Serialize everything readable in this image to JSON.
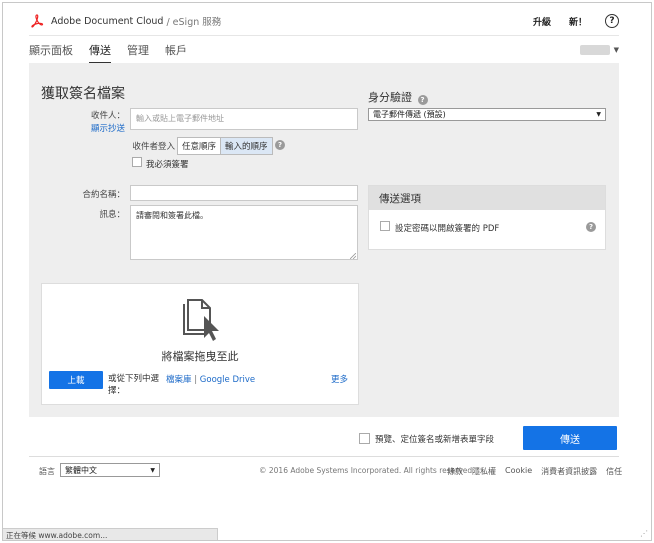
{
  "header": {
    "app_title": "Adobe Document Cloud",
    "app_sub": "/ eSign 服務",
    "upgrade": "升級",
    "whats_new": "新！",
    "help": "?"
  },
  "nav": {
    "tabs": [
      {
        "label": "顯示面板"
      },
      {
        "label": "傳送"
      },
      {
        "label": "管理"
      },
      {
        "label": "帳戶"
      }
    ],
    "active": "傳送"
  },
  "form": {
    "heading": "獲取簽名檔案",
    "recipient_label": "收件人：",
    "show_cc": "顯示抄送",
    "recipient_placeholder": "輸入或貼上電子郵件地址",
    "order_label": "收件者登入",
    "order_any": "任意順序",
    "order_entered": "輸入的順序",
    "i_must_sign": "我必須簽署",
    "agreement_label": "合約名稱：",
    "agreement_value": "",
    "message_label": "訊息：",
    "message_value": "請審閱和簽署此檔。"
  },
  "auth": {
    "title": "身分驗證",
    "selected": "電子郵件傳遞 (預設)"
  },
  "options": {
    "title": "傳送選項",
    "password_option": "設定密碼以開啟簽署的 PDF"
  },
  "upload": {
    "drop_text": "將檔案拖曳至此",
    "upload_button": "上載",
    "or_select": "或從下列中選擇：",
    "library": "檔案庫",
    "separator": " | ",
    "google_drive": "Google Drive",
    "more": "更多"
  },
  "actions": {
    "preview_label": "預覽、定位簽名或新增表單字段",
    "send_button": "傳送"
  },
  "footer": {
    "language_label": "語言",
    "language_value": "繁體中文",
    "copyright": "© 2016 Adobe Systems Incorporated. All rights reserved.",
    "links": [
      "條款",
      "隱私權",
      "Cookie",
      "消費者資訊披露",
      "信任"
    ]
  },
  "status_bar": {
    "text": "正在等候 www.adobe.com..."
  },
  "colors": {
    "accent": "#1473e6",
    "link": "#1c6ac8",
    "panel_bg": "#eeeeee"
  }
}
